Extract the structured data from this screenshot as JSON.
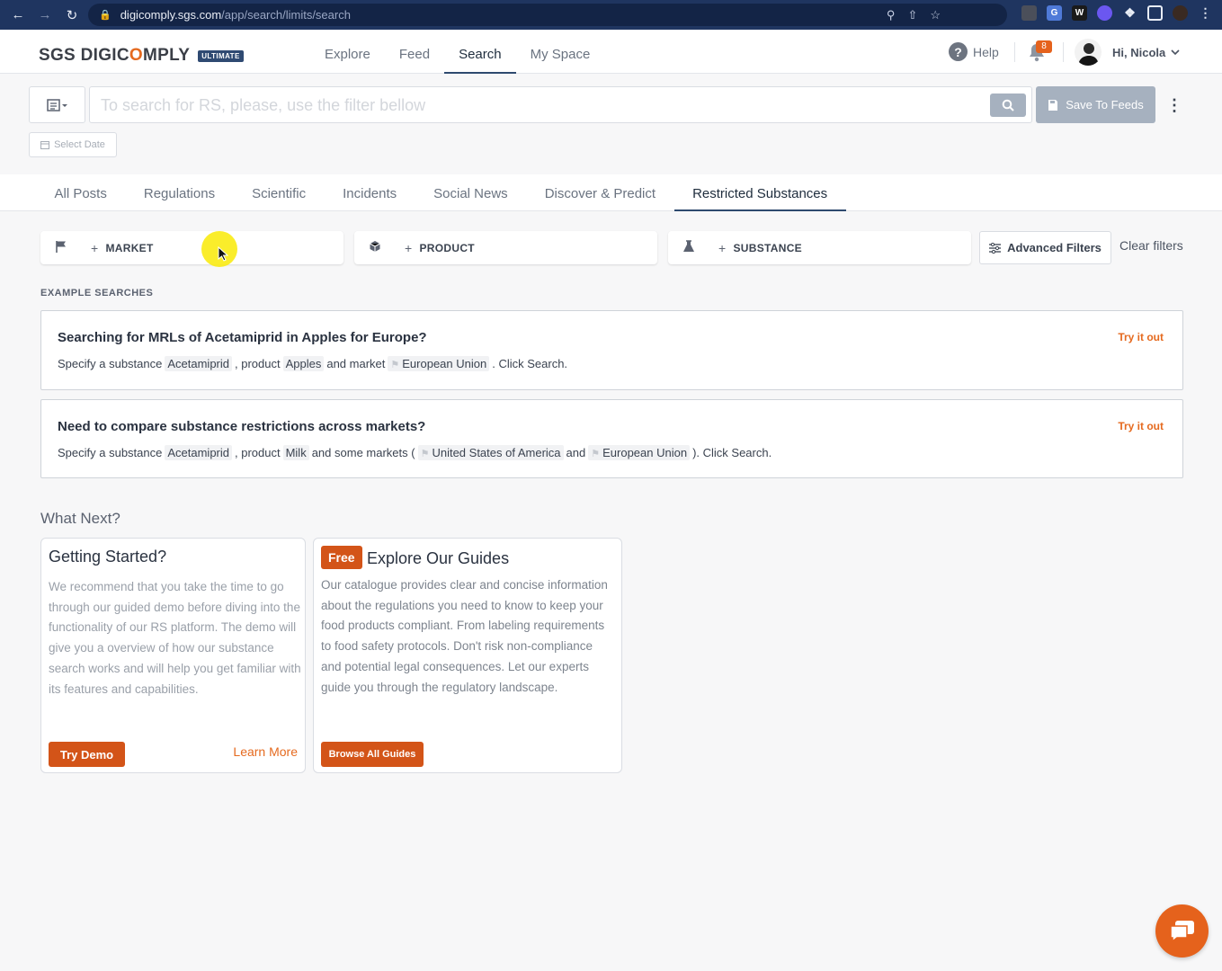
{
  "browser": {
    "url_host": "digicomply.sgs.com",
    "url_path": "/app/search/limits/search"
  },
  "brand": {
    "logo_prefix": "SGS DIGIC",
    "logo_o": "O",
    "logo_suffix": "MPLY",
    "edition_badge": "ULTIMATE",
    "accent": "#e56a1f",
    "primary": "#2e4a6f"
  },
  "main_nav": {
    "items": [
      {
        "label": "Explore"
      },
      {
        "label": "Feed"
      },
      {
        "label": "Search",
        "active": true
      },
      {
        "label": "My Space"
      }
    ]
  },
  "header": {
    "help_label": "Help",
    "notification_count": "8",
    "greeting": "Hi, Nicola"
  },
  "search": {
    "placeholder": "To search for RS, please, use the filter bellow",
    "save_label": "Save To Feeds",
    "date_label": "Select Date"
  },
  "content_tabs": [
    {
      "label": "All Posts"
    },
    {
      "label": "Regulations"
    },
    {
      "label": "Scientific"
    },
    {
      "label": "Incidents"
    },
    {
      "label": "Social News"
    },
    {
      "label": "Discover & Predict"
    },
    {
      "label": "Restricted Substances",
      "active": true
    }
  ],
  "filters": {
    "market": "MARKET",
    "product": "PRODUCT",
    "substance": "SUBSTANCE",
    "advanced": "Advanced Filters",
    "clear": "Clear filters"
  },
  "examples": {
    "section_label": "EXAMPLE SEARCHES",
    "try_label": "Try it out",
    "one": {
      "title": "Searching for MRLs of Acetamiprid in Apples for Europe?",
      "t1": "Specify a substance",
      "substance": "Acetamiprid",
      "t2": ", product",
      "product": "Apples",
      "t3": "and market",
      "market": "European Union",
      "t4": ". Click Search."
    },
    "two": {
      "title": "Need to compare substance restrictions across markets?",
      "t1": "Specify a substance",
      "substance": "Acetamiprid",
      "t2": ", product",
      "product": "Milk",
      "t3": "and some markets (",
      "market1": "United States of America",
      "t4": "and",
      "market2": "European Union",
      "t5": "). Click Search."
    }
  },
  "what_next": {
    "heading": "What Next?",
    "getting_started": {
      "title": "Getting Started?",
      "body": "We recommend that you take the time to go through our guided demo before diving into the functionality of our RS platform. The demo will give you a overview of how our substance search works and will help you get familiar with its features and capabilities.",
      "button": "Try Demo",
      "link": "Learn More"
    },
    "guides": {
      "badge": "Free",
      "title": "Explore Our Guides",
      "body": "Our catalogue provides clear and concise information about the regulations you need to know to keep your food products compliant. From labeling requirements to food safety protocols. Don't risk non-compliance and potential legal consequences. Let our experts guide you through the regulatory landscape.",
      "button": "Browse All Guides"
    }
  }
}
